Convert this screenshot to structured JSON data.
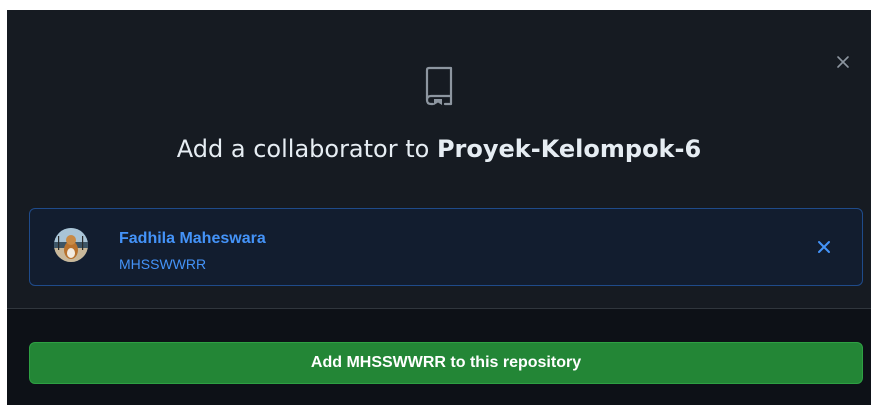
{
  "dialog": {
    "title_prefix": "Add a collaborator to ",
    "repo_name": "Proyek-Kelompok-6",
    "close_icon": "close-icon",
    "header_icon": "repo-icon"
  },
  "selected_user": {
    "name": "Fadhila Maheswara",
    "login": "MHSSWWRR",
    "avatar_icon": "avatar",
    "remove_icon": "close-icon"
  },
  "footer": {
    "add_button_label": "Add MHSSWWRR to this repository"
  },
  "colors": {
    "dialog_bg": "#161b22",
    "footer_bg": "#0d1117",
    "accent_blue": "#4493f8",
    "selected_bg": "#121d2f",
    "selected_border": "#1f4b8a",
    "button_green": "#238636",
    "text": "#e6edf3"
  }
}
